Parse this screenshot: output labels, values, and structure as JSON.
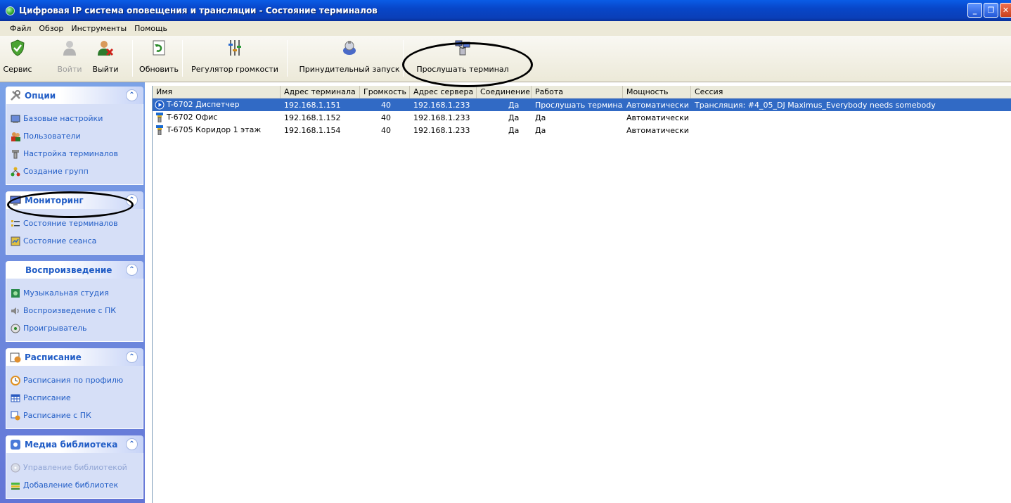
{
  "window": {
    "title": "Цифровая IP система оповещения и трансляции  -  Состояние терминалов",
    "minimize_label": "_",
    "restore_label": "❐"
  },
  "menu": {
    "items": [
      "Файл",
      "Обзор",
      "Инструменты",
      "Помощь"
    ]
  },
  "toolbar": {
    "buttons": [
      {
        "label": "Сервис",
        "icon": "shield-check-icon",
        "enabled": true
      },
      {
        "label": "Войти",
        "icon": "user-login-icon",
        "enabled": false
      },
      {
        "label": "Выйти",
        "icon": "user-logout-icon",
        "enabled": true
      },
      {
        "label": "Обновить",
        "icon": "refresh-icon",
        "enabled": true
      },
      {
        "label": "Регулятор громкости",
        "icon": "volume-slider-icon",
        "enabled": true
      },
      {
        "label": "Принудительный запуск",
        "icon": "force-start-icon",
        "enabled": true
      },
      {
        "label": "Прослушать терминал",
        "icon": "listen-terminal-icon",
        "enabled": true
      }
    ]
  },
  "sidebar": {
    "panels": [
      {
        "title": "Опции",
        "icon": "tools-icon",
        "items": [
          {
            "label": "Базовые настройки",
            "icon": "settings-icon"
          },
          {
            "label": "Пользователи",
            "icon": "users-icon"
          },
          {
            "label": "Настройка терминалов",
            "icon": "terminal-icon"
          },
          {
            "label": "Создание групп",
            "icon": "group-icon"
          }
        ]
      },
      {
        "title": "Мониторинг",
        "icon": "monitor-icon",
        "items": [
          {
            "label": "Состояние терминалов",
            "icon": "terminal-state-icon"
          },
          {
            "label": "Состояние сеанса",
            "icon": "session-state-icon"
          }
        ]
      },
      {
        "title": "Воспроизведение",
        "icon": "",
        "items": [
          {
            "label": "Музыкальная студия",
            "icon": "music-studio-icon"
          },
          {
            "label": "Воспроизведение с ПК",
            "icon": "speaker-icon"
          },
          {
            "label": "Проигрыватель",
            "icon": "player-icon"
          }
        ]
      },
      {
        "title": "Расписание",
        "icon": "schedule-icon",
        "items": [
          {
            "label": "Расписания по профилю",
            "icon": "clock-icon"
          },
          {
            "label": "Расписание",
            "icon": "table-icon"
          },
          {
            "label": "Расписание с ПК",
            "icon": "pc-schedule-icon"
          }
        ]
      },
      {
        "title": "Медиа библиотека",
        "icon": "media-library-icon",
        "items": [
          {
            "label": "Управление библиотекой",
            "icon": "disc-icon",
            "enabled": false
          },
          {
            "label": "Добавление библиотек",
            "icon": "add-library-icon"
          }
        ]
      }
    ]
  },
  "terminals": {
    "columns": [
      "Имя",
      "Адрес терминала",
      "Громкость",
      "Адрес сервера",
      "Соединение",
      "Работа",
      "Мощность",
      "Сессия"
    ],
    "rows": [
      {
        "name": "T-6702 Диспетчер",
        "address": "192.168.1.151",
        "volume": "40",
        "server": "192.168.1.233",
        "connection": "Да",
        "work": "Прослушать терминал",
        "power": "Автоматически",
        "session": "Трансляция: #4_05_DJ Maximus_Everybody needs somebody",
        "selected": true
      },
      {
        "name": "T-6702 Офис",
        "address": "192.168.1.152",
        "volume": "40",
        "server": "192.168.1.233",
        "connection": "Да",
        "work": "Да",
        "power": "Автоматически",
        "session": "",
        "selected": false
      },
      {
        "name": "T-6705 Коридор 1 этаж",
        "address": "192.168.1.154",
        "volume": "40",
        "server": "192.168.1.233",
        "connection": "Да",
        "work": "Да",
        "power": "Автоматически",
        "session": "",
        "selected": false
      }
    ]
  },
  "colors": {
    "titlebar": "#0846c8",
    "selection": "#316ac5",
    "sidebar_link": "#215dc6"
  }
}
